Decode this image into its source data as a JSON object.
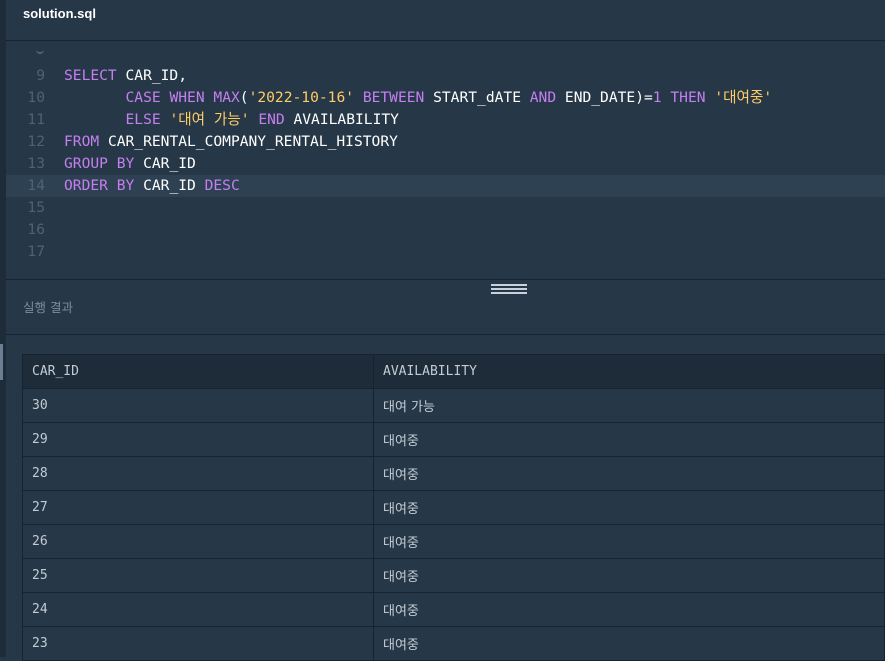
{
  "file_tab": "solution.sql",
  "editor": {
    "lines": [
      {
        "n": "9",
        "tokens": [
          [
            "kw",
            "SELECT"
          ],
          [
            "id",
            " CAR_ID,"
          ]
        ]
      },
      {
        "n": "10",
        "tokens": [
          [
            "id",
            "       "
          ],
          [
            "kw",
            "CASE"
          ],
          [
            "id",
            " "
          ],
          [
            "kw",
            "WHEN"
          ],
          [
            "id",
            " "
          ],
          [
            "kw",
            "MAX"
          ],
          [
            "id",
            "("
          ],
          [
            "str",
            "'2022-10-16'"
          ],
          [
            "id",
            " "
          ],
          [
            "kw",
            "BETWEEN"
          ],
          [
            "id",
            " START_dATE "
          ],
          [
            "kw",
            "AND"
          ],
          [
            "id",
            " END_DATE)="
          ],
          [
            "num",
            "1"
          ],
          [
            "id",
            " "
          ],
          [
            "kw",
            "THEN"
          ],
          [
            "id",
            " "
          ],
          [
            "str",
            "'대여중'"
          ]
        ]
      },
      {
        "n": "11",
        "tokens": [
          [
            "id",
            "       "
          ],
          [
            "kw",
            "ELSE"
          ],
          [
            "id",
            " "
          ],
          [
            "str",
            "'대여 가능'"
          ],
          [
            "id",
            " "
          ],
          [
            "kw",
            "END"
          ],
          [
            "id",
            " AVAILABILITY"
          ]
        ]
      },
      {
        "n": "12",
        "tokens": [
          [
            "kw",
            "FROM"
          ],
          [
            "id",
            " CAR_RENTAL_COMPANY_RENTAL_HISTORY"
          ]
        ]
      },
      {
        "n": "13",
        "tokens": [
          [
            "kw",
            "GROUP BY"
          ],
          [
            "id",
            " CAR_ID"
          ]
        ]
      },
      {
        "n": "14",
        "tokens": [
          [
            "kw",
            "ORDER BY"
          ],
          [
            "id",
            " CAR_ID "
          ],
          [
            "kw",
            "DESC"
          ]
        ]
      },
      {
        "n": "15",
        "tokens": []
      },
      {
        "n": "16",
        "tokens": []
      },
      {
        "n": "17",
        "tokens": []
      }
    ]
  },
  "results": {
    "title": "실행 결과",
    "columns": [
      "CAR_ID",
      "AVAILABILITY"
    ],
    "rows": [
      [
        "30",
        "대여 가능"
      ],
      [
        "29",
        "대여중"
      ],
      [
        "28",
        "대여중"
      ],
      [
        "27",
        "대여중"
      ],
      [
        "26",
        "대여중"
      ],
      [
        "25",
        "대여중"
      ],
      [
        "24",
        "대여중"
      ],
      [
        "23",
        "대여중"
      ]
    ]
  },
  "colors": {
    "background": "#263747",
    "keyword": "#c57ff0",
    "string": "#ffcc66",
    "identifier": "#ffffff",
    "line_number": "#4f6274"
  }
}
